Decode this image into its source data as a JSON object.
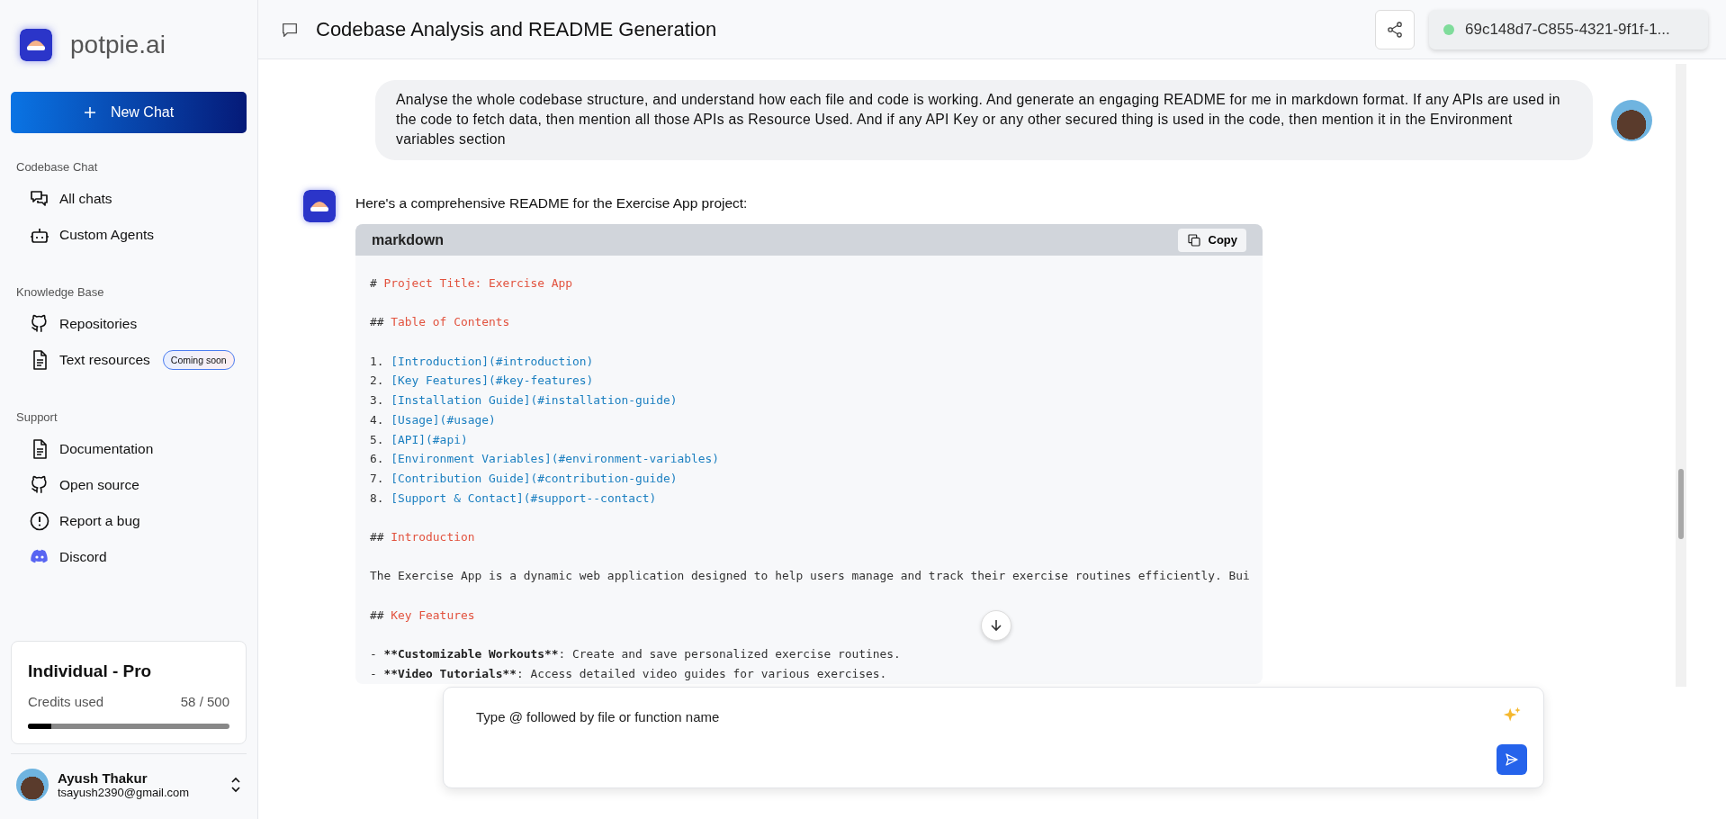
{
  "sidebar": {
    "brand": "potpie.ai",
    "new_chat": "New Chat",
    "sections": [
      {
        "title": "Codebase Chat",
        "items": [
          {
            "kind": "chats",
            "label": "All chats"
          },
          {
            "kind": "robot",
            "label": "Custom Agents"
          }
        ]
      },
      {
        "title": "Knowledge Base",
        "items": [
          {
            "kind": "github",
            "label": "Repositories"
          },
          {
            "kind": "file",
            "label": "Text resources",
            "badge": "Coming soon"
          }
        ]
      },
      {
        "title": "Support",
        "items": [
          {
            "kind": "file",
            "label": "Documentation"
          },
          {
            "kind": "github",
            "label": "Open source"
          },
          {
            "kind": "alert",
            "label": "Report a bug"
          },
          {
            "kind": "discord",
            "label": "Discord"
          }
        ]
      }
    ],
    "plan": {
      "name": "Individual - Pro",
      "credits_label": "Credits used",
      "credits": "58 / 500",
      "level": 0.116
    },
    "user": {
      "name": "Ayush Thakur",
      "email": "tsayush2390@gmail.com"
    }
  },
  "header": {
    "title": "Codebase Analysis and README Generation",
    "session": "69c148d7-C855-4321-9f1f-1..."
  },
  "messages": [
    {
      "kind": "user",
      "text": "Analyse the whole codebase structure, and understand how each file and code is working. And generate an engaging README for me in markdown format. If any APIs are used in the code to fetch data, then mention all those APIs as Resource Used. And if any API Key or any other secured thing is used in the code, then mention it in the Environment variables section"
    },
    {
      "kind": "bot",
      "text": "Here's a comprehensive README for the Exercise App project:",
      "code": {
        "language": "markdown",
        "copy": "Copy",
        "lines": [
          {
            "parts": [
              {
                "kind": "mark",
                "text": "# "
              },
              {
                "kind": "heading",
                "text": "Project Title: Exercise App"
              }
            ]
          },
          {
            "kind": "blank"
          },
          {
            "parts": [
              {
                "kind": "mark",
                "text": "## "
              },
              {
                "kind": "heading",
                "text": "Table of Contents"
              }
            ]
          },
          {
            "kind": "blank"
          },
          {
            "parts": [
              {
                "kind": "mark",
                "text": "1. "
              },
              {
                "kind": "link",
                "text": "[Introduction](#introduction)"
              }
            ]
          },
          {
            "parts": [
              {
                "kind": "mark",
                "text": "2. "
              },
              {
                "kind": "link",
                "text": "[Key Features](#key-features)"
              }
            ]
          },
          {
            "parts": [
              {
                "kind": "mark",
                "text": "3. "
              },
              {
                "kind": "link",
                "text": "[Installation Guide](#installation-guide)"
              }
            ]
          },
          {
            "parts": [
              {
                "kind": "mark",
                "text": "4. "
              },
              {
                "kind": "link",
                "text": "[Usage](#usage)"
              }
            ]
          },
          {
            "parts": [
              {
                "kind": "mark",
                "text": "5. "
              },
              {
                "kind": "link",
                "text": "[API](#api)"
              }
            ]
          },
          {
            "parts": [
              {
                "kind": "mark",
                "text": "6. "
              },
              {
                "kind": "link",
                "text": "[Environment Variables](#environment-variables)"
              }
            ]
          },
          {
            "parts": [
              {
                "kind": "mark",
                "text": "7. "
              },
              {
                "kind": "link",
                "text": "[Contribution Guide](#contribution-guide)"
              }
            ]
          },
          {
            "parts": [
              {
                "kind": "mark",
                "text": "8. "
              },
              {
                "kind": "link",
                "text": "[Support & Contact](#support--contact)"
              }
            ]
          },
          {
            "kind": "blank"
          },
          {
            "parts": [
              {
                "kind": "mark",
                "text": "## "
              },
              {
                "kind": "heading",
                "text": "Introduction"
              }
            ]
          },
          {
            "kind": "blank"
          },
          {
            "parts": [
              {
                "kind": "text",
                "text": "The Exercise App is a dynamic web application designed to help users manage and track their exercise routines efficiently. Bui"
              }
            ]
          },
          {
            "kind": "blank"
          },
          {
            "parts": [
              {
                "kind": "mark",
                "text": "## "
              },
              {
                "kind": "heading",
                "text": "Key Features"
              }
            ]
          },
          {
            "kind": "blank"
          },
          {
            "parts": [
              {
                "kind": "mark",
                "text": "- "
              },
              {
                "kind": "bold",
                "text": "**Customizable Workouts**"
              },
              {
                "kind": "text",
                "text": ": Create and save personalized exercise routines."
              }
            ]
          },
          {
            "parts": [
              {
                "kind": "mark",
                "text": "- "
              },
              {
                "kind": "bold",
                "text": "**Video Tutorials**"
              },
              {
                "kind": "text",
                "text": ": Access detailed video guides for various exercises."
              }
            ]
          }
        ]
      }
    }
  ],
  "composer": {
    "placeholder": "Type @ followed by file or function name"
  }
}
